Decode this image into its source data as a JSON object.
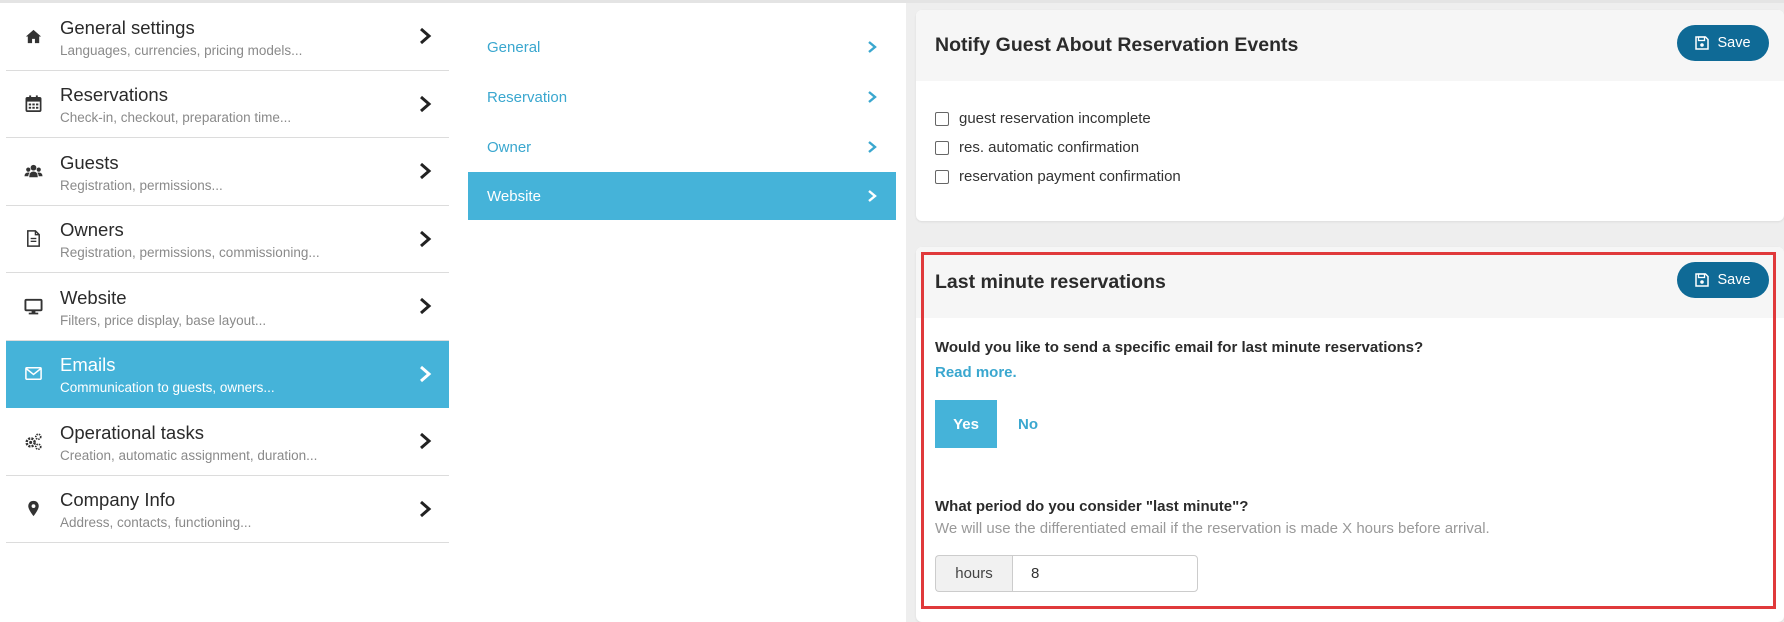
{
  "settings_menu": {
    "items": [
      {
        "title": "General settings",
        "subtitle": "Languages, currencies, pricing models...",
        "icon": "home-icon"
      },
      {
        "title": "Reservations",
        "subtitle": "Check-in, checkout, preparation time...",
        "icon": "calendar-icon"
      },
      {
        "title": "Guests",
        "subtitle": "Registration, permissions...",
        "icon": "users-icon"
      },
      {
        "title": "Owners",
        "subtitle": "Registration, permissions, commissioning...",
        "icon": "document-icon"
      },
      {
        "title": "Website",
        "subtitle": "Filters, price display, base layout...",
        "icon": "monitor-icon"
      },
      {
        "title": "Emails",
        "subtitle": "Communication to guests, owners...",
        "icon": "envelope-icon",
        "active": true
      },
      {
        "title": "Operational tasks",
        "subtitle": "Creation, automatic assignment, duration...",
        "icon": "gears-icon"
      },
      {
        "title": "Company Info",
        "subtitle": "Address, contacts, functioning...",
        "icon": "map-pin-icon"
      }
    ]
  },
  "email_submenu": {
    "items": [
      {
        "label": "General"
      },
      {
        "label": "Reservation"
      },
      {
        "label": "Owner"
      },
      {
        "label": "Website",
        "active": true
      }
    ]
  },
  "notify_card": {
    "title": "Notify Guest About Reservation Events",
    "save_label": "Save",
    "checkboxes": [
      {
        "label": "guest reservation incomplete",
        "checked": false
      },
      {
        "label": "res. automatic confirmation",
        "checked": false
      },
      {
        "label": "reservation payment confirmation",
        "checked": false
      }
    ]
  },
  "last_minute_card": {
    "title": "Last minute reservations",
    "save_label": "Save",
    "question": "Would you like to send a specific email for last minute reservations?",
    "read_more": "Read more.",
    "toggle": {
      "yes": "Yes",
      "no": "No",
      "selected": "Yes"
    },
    "period_question": "What period do you consider \"last minute\"?",
    "period_hint": "We will use the differentiated email if the reservation is made X hours before arrival.",
    "hours_addon": "hours",
    "hours_value": "8"
  },
  "colors": {
    "accent": "#45b3d9",
    "save_button": "#0f6a96",
    "highlight_border": "#e0393b"
  }
}
